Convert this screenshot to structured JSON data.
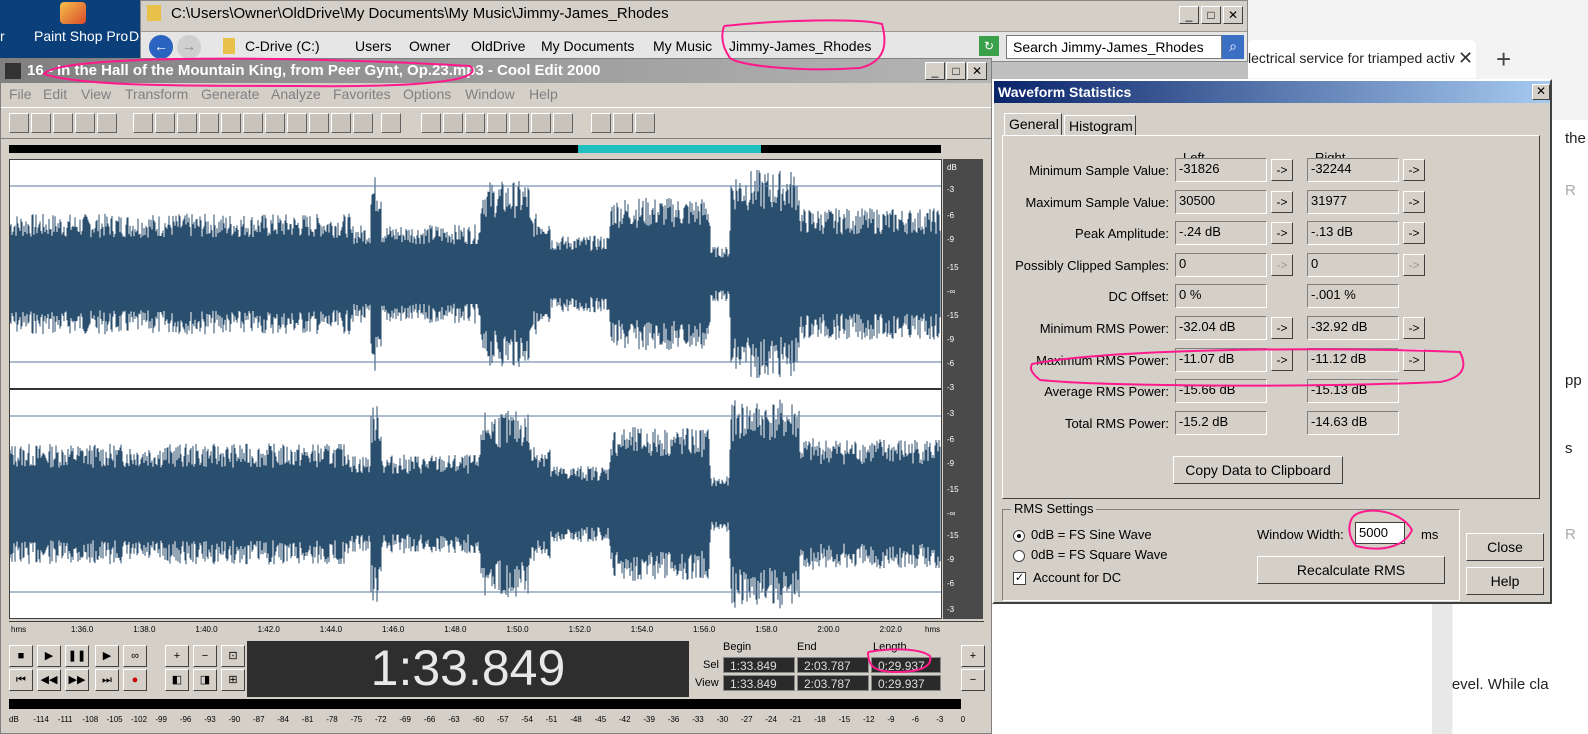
{
  "desktop": {
    "left_fragment": "r",
    "icon_label": "Paint Shop Pro",
    "right_fragment": "D",
    "icon_name": "paint-shop-pro-icon"
  },
  "explorer": {
    "title": "C:\\Users\\Owner\\OldDrive\\My Documents\\My Music\\Jimmy-James_Rhodes",
    "crumbs": [
      "C-Drive (C:)",
      "Users",
      "Owner",
      "OldDrive",
      "My Documents",
      "My Music",
      "Jimmy-James_Rhodes"
    ],
    "search_placeholder": "Search Jimmy-James_Rhodes"
  },
  "browser": {
    "tab_title": "lectrical service for triamped activ",
    "fragments": [
      "the",
      "R",
      "pp",
      "s",
      "R",
      "g level. While cla"
    ]
  },
  "cooledit": {
    "title": "16 - In the Hall of the Mountain King, from Peer Gynt, Op.23.mp3 - Cool Edit 2000",
    "menu": [
      "File",
      "Edit",
      "View",
      "Transform",
      "Generate",
      "Analyze",
      "Favorites",
      "Options",
      "Window",
      "Help"
    ],
    "db_labels_top": [
      "dB",
      "-3",
      "-6",
      "-9",
      "-15",
      "-∞",
      "-15",
      "-9",
      "-6",
      "-3"
    ],
    "db_labels_bottom": [
      "-3",
      "-6",
      "-9",
      "-15",
      "-∞",
      "-15",
      "-9",
      "-6",
      "-3"
    ],
    "timeline": [
      "hms",
      "1:36.0",
      "1:38.0",
      "1:40.0",
      "1:42.0",
      "1:44.0",
      "1:46.0",
      "1:48.0",
      "1:50.0",
      "1:52.0",
      "1:54.0",
      "1:56.0",
      "1:58.0",
      "2:00.0",
      "2:02.0",
      "hms"
    ],
    "time_display": "1:33.849",
    "sel_label": "Sel",
    "view_label": "View",
    "col_begin": "Begin",
    "col_end": "End",
    "col_length": "Length",
    "sel": {
      "begin": "1:33.849",
      "end": "2:03.787",
      "length": "0:29.937"
    },
    "view": {
      "begin": "1:33.849",
      "end": "2:03.787",
      "length": "0:29.937"
    },
    "level_ticks": [
      "dB",
      "-114",
      "-111",
      "-108",
      "-105",
      "-102",
      "-99",
      "-96",
      "-93",
      "-90",
      "-87",
      "-84",
      "-81",
      "-78",
      "-75",
      "-72",
      "-69",
      "-66",
      "-63",
      "-60",
      "-57",
      "-54",
      "-51",
      "-48",
      "-45",
      "-42",
      "-39",
      "-36",
      "-33",
      "-30",
      "-27",
      "-24",
      "-21",
      "-18",
      "-15",
      "-12",
      "-9",
      "-6",
      "-3",
      "0"
    ],
    "wave_color": "#2a4e6e"
  },
  "dialog": {
    "title": "Waveform Statistics",
    "tabs": [
      "General",
      "Histogram"
    ],
    "col_left": "Left",
    "col_right": "Right",
    "rows": [
      {
        "label": "Minimum Sample Value:",
        "left": "-31826",
        "right": "-32244",
        "has_arrow": true,
        "arrow_disabled": false
      },
      {
        "label": "Maximum Sample Value:",
        "left": "30500",
        "right": "31977",
        "has_arrow": true,
        "arrow_disabled": false
      },
      {
        "label": "Peak Amplitude:",
        "left": "-.24 dB",
        "right": "-.13 dB",
        "has_arrow": true,
        "arrow_disabled": false
      },
      {
        "label": "Possibly Clipped Samples:",
        "left": "0",
        "right": "0",
        "has_arrow": true,
        "arrow_disabled": true
      },
      {
        "label": "DC Offset:",
        "left": "0 %",
        "right": "-.001 %",
        "has_arrow": false,
        "arrow_disabled": false
      },
      {
        "label": "Minimum RMS Power:",
        "left": "-32.04 dB",
        "right": "-32.92 dB",
        "has_arrow": true,
        "arrow_disabled": false
      },
      {
        "label": "Maximum RMS Power:",
        "left": "-11.07 dB",
        "right": "-11.12 dB",
        "has_arrow": true,
        "arrow_disabled": false
      },
      {
        "label": "Average RMS Power:",
        "left": "-15.66 dB",
        "right": "-15.13 dB",
        "has_arrow": false,
        "arrow_disabled": false
      },
      {
        "label": "Total RMS Power:",
        "left": "-15.2 dB",
        "right": "-14.63 dB",
        "has_arrow": false,
        "arrow_disabled": false
      }
    ],
    "arrow_glyph": "->",
    "copy_button": "Copy Data to Clipboard",
    "rms_group": "RMS Settings",
    "radio1": "0dB = FS Sine Wave",
    "radio2": "0dB = FS Square Wave",
    "check": "Account for DC",
    "window_width_label": "Window Width:",
    "window_width_value": "5000",
    "window_width_unit": "ms",
    "recalc_button": "Recalculate RMS",
    "close_button": "Close",
    "help_button": "Help"
  },
  "annotation_color": "#ff1a8c"
}
